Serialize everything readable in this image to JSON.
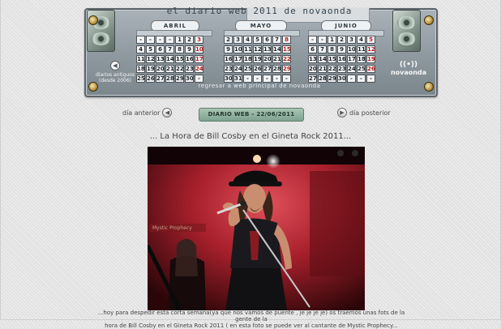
{
  "header": {
    "title": "el diario web 2011 de novaonda",
    "old_diaries_label": "diarios antiguos (desde 2006)",
    "brand": "novaonda",
    "footer_link": "regresar a web principal de novaonda"
  },
  "calendar": [
    {
      "name": "ABRIL",
      "weeks": [
        [
          "-",
          "-",
          "-",
          "-",
          "1",
          "2",
          "3"
        ],
        [
          "4",
          "5",
          "6",
          "7",
          "8",
          "9",
          "10"
        ],
        [
          "11",
          "12",
          "13",
          "14",
          "15",
          "16",
          "17"
        ],
        [
          "18",
          "19",
          "20",
          "21",
          "22",
          "23",
          "24"
        ],
        [
          "25",
          "26",
          "27",
          "28",
          "29",
          "30",
          "-"
        ]
      ]
    },
    {
      "name": "MAYO",
      "weeks": [
        [
          "2",
          "3",
          "4",
          "5",
          "6",
          "7",
          "8"
        ],
        [
          "9",
          "10",
          "11",
          "12",
          "13",
          "14",
          "15"
        ],
        [
          "16",
          "17",
          "18",
          "19",
          "20",
          "21",
          "22"
        ],
        [
          "23",
          "24",
          "25",
          "26",
          "27",
          "28",
          "29"
        ],
        [
          "30",
          "31",
          "-",
          "-",
          "-",
          "-",
          "-"
        ]
      ]
    },
    {
      "name": "JUNIO",
      "weeks": [
        [
          "-",
          "-",
          "1",
          "2",
          "3",
          "4",
          "5"
        ],
        [
          "6",
          "7",
          "8",
          "9",
          "10",
          "11",
          "12"
        ],
        [
          "13",
          "14",
          "15",
          "16",
          "17",
          "18",
          "19"
        ],
        [
          "20",
          "21",
          "22",
          "23",
          "24",
          "25",
          "26"
        ],
        [
          "27",
          "28",
          "29",
          "30",
          "-",
          "-",
          "-"
        ]
      ]
    }
  ],
  "nav": {
    "previous": "día anterior",
    "next": "día posterior",
    "current_date": "DIARIO WEB - 22/06/2011"
  },
  "article": {
    "headline": "... La Hora de Bill Cosby en el Gineta Rock 2011...",
    "caption_line1": "...hoy para despedir esta corta semana(ya que nos vamos de puente , je je je je) os traemos unas fots de la gente de la",
    "caption_line2": "hora de Bill Cosby en el Gineta Rock 2011 ( en esta foto se puede ver al cantante de Mystic Prophecy..."
  },
  "colors": {
    "sunday_red": "#c21818",
    "panel_grey": "#8e989f",
    "badge_green": "#7ea290"
  }
}
